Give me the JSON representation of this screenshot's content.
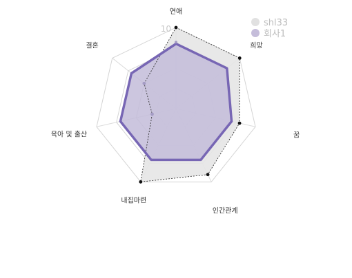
{
  "chart_data": {
    "type": "radar",
    "axes": [
      "연애",
      "희망",
      "꿈",
      "인간관계",
      "내집마련",
      "육아 및 출산",
      "결혼"
    ],
    "rmax": 10,
    "tick_labels": [
      "10"
    ],
    "grid": true,
    "legend_position": "top-right",
    "series": [
      {
        "name": "shl33",
        "values": [
          10,
          10,
          8,
          9,
          10,
          3,
          5
        ],
        "color": "#bdbdbd",
        "fill": "#e5e5e5"
      },
      {
        "name": "회사1",
        "values": [
          8,
          8,
          7,
          7,
          7,
          7,
          7
        ],
        "color": "#7766b4",
        "fill": "#c3bcd9"
      }
    ]
  }
}
